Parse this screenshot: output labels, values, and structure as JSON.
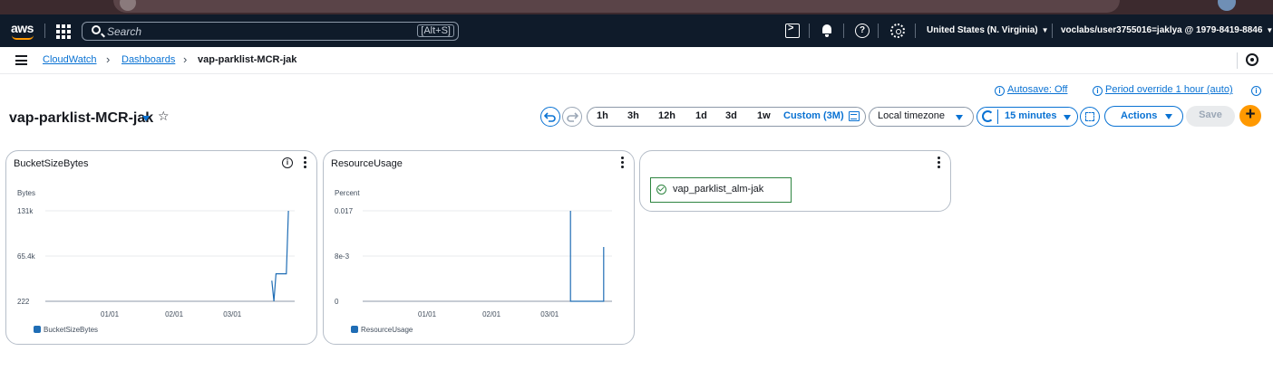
{
  "topnav": {
    "logo_text": "aws",
    "search_placeholder": "Search",
    "search_shortcut": "[Alt+S]",
    "region": "United States (N. Virginia)",
    "account": "voclabs/user3755016=jaklya @ 1979-8419-8846"
  },
  "breadcrumb": {
    "items": [
      "CloudWatch",
      "Dashboards"
    ],
    "current": "vap-parklist-MCR-jak"
  },
  "dashboard": {
    "title": "vap-parklist-MCR-jak",
    "autosave": "Autosave: Off",
    "period_override": "Period override 1 hour (auto)",
    "time_ranges": [
      "1h",
      "3h",
      "12h",
      "1d",
      "3d",
      "1w"
    ],
    "custom_range": "Custom (3M)",
    "timezone": "Local timezone",
    "refresh_interval": "15 minutes",
    "actions_label": "Actions",
    "save_label": "Save"
  },
  "colors": {
    "accent": "#0972d3",
    "series": "#1f6db5",
    "alarm_ok": "#2e8540",
    "add_button": "#ff9900",
    "nav_bg": "#0f1b2a"
  },
  "widgets": [
    {
      "title": "BucketSizeBytes",
      "unit": "Bytes",
      "legend": "BucketSizeBytes"
    },
    {
      "title": "ResourceUsage",
      "unit": "Percent",
      "legend": "ResourceUsage"
    },
    {
      "title": "",
      "alarm_name": "vap_parklist_alm-jak",
      "alarm_state": "OK"
    }
  ],
  "chart_data": [
    {
      "type": "line",
      "title": "BucketSizeBytes",
      "ylabel": "Bytes",
      "y_ticks": [
        "131k",
        "65.4k",
        "222"
      ],
      "x_ticks": [
        "01/01",
        "02/01",
        "03/01"
      ],
      "ylim": [
        222,
        131000
      ],
      "series": [
        {
          "name": "BucketSizeBytes",
          "x": [
            "03/20",
            "03/21",
            "03/22",
            "03/23",
            "03/27",
            "03/28"
          ],
          "values": [
            30000,
            222,
            40000,
            40000,
            40000,
            131000
          ]
        }
      ]
    },
    {
      "type": "line",
      "title": "ResourceUsage",
      "ylabel": "Percent",
      "y_ticks": [
        "0.017",
        "8e-3",
        "0"
      ],
      "x_ticks": [
        "01/01",
        "02/01",
        "03/01"
      ],
      "ylim": [
        0,
        0.017
      ],
      "series": [
        {
          "name": "ResourceUsage",
          "x": [
            "03/11",
            "03/11",
            "03/27",
            "03/27"
          ],
          "values": [
            0.017,
            0,
            0,
            0.0102
          ]
        }
      ]
    }
  ]
}
